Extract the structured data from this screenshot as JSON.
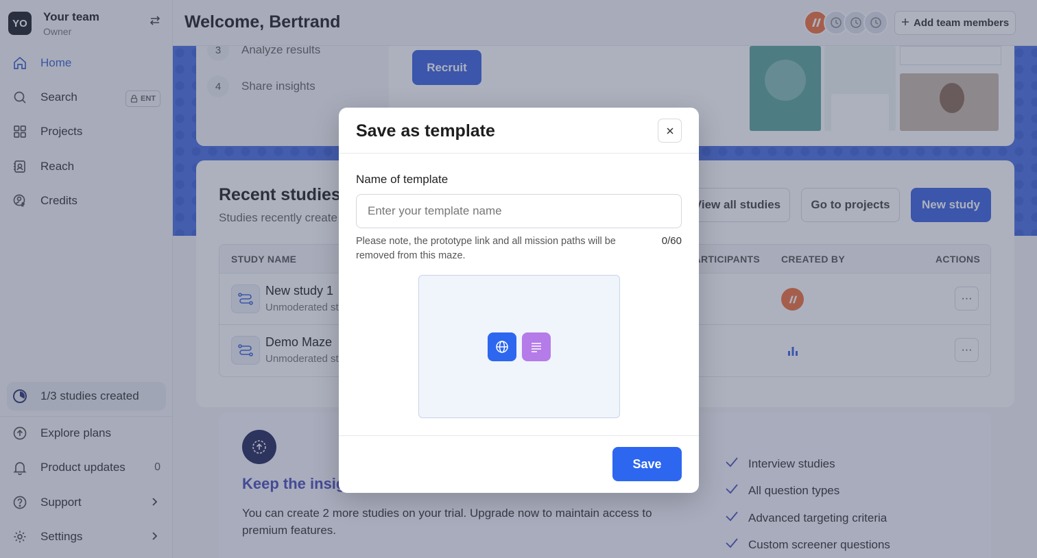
{
  "team": {
    "initials": "YO",
    "name": "Your team",
    "role": "Owner"
  },
  "nav": {
    "home": "Home",
    "search": "Search",
    "search_badge": "ENT",
    "projects": "Projects",
    "reach": "Reach",
    "credits": "Credits"
  },
  "studies_created": "1/3 studies created",
  "bottom_nav": {
    "explore_plans": "Explore plans",
    "product_updates": "Product updates",
    "product_updates_count": "0",
    "support": "Support",
    "settings": "Settings"
  },
  "header": {
    "welcome": "Welcome, Bertrand",
    "add_team": "Add team members"
  },
  "hero": {
    "steps": [
      {
        "num": "3",
        "label": "Analyze results"
      },
      {
        "num": "4",
        "label": "Share insights"
      }
    ],
    "recruit": "Recruit"
  },
  "recent": {
    "title": "Recent studies",
    "subtitle": "Studies recently create",
    "view_all": "View all studies",
    "go_projects": "Go to projects",
    "new_study": "New study",
    "columns": {
      "name": "STUDY NAME",
      "participants": "PARTICIPANTS",
      "created_by": "CREATED BY",
      "actions": "ACTIONS"
    },
    "rows": [
      {
        "name": "New study 1",
        "type": "Unmoderated study"
      },
      {
        "name": "Demo Maze",
        "type": "Unmoderated study"
      }
    ],
    "actions_glyph": "···"
  },
  "upgrade": {
    "title": "Keep the insights flowing",
    "text": "You can create 2 more studies on your trial. Upgrade now to maintain access to premium features.",
    "features": [
      "Interview studies",
      "All question types",
      "Advanced targeting criteria",
      "Custom screener questions"
    ]
  },
  "modal": {
    "title": "Save as template",
    "field_label": "Name of template",
    "placeholder": "Enter your template name",
    "note": "Please note, the prototype link and all mission paths will be removed from this maze.",
    "counter": "0/60",
    "save": "Save"
  },
  "colors": {
    "accent": "#3c63dd",
    "save": "#2d67f0",
    "brand_orange": "#f2703a",
    "purple": "#b57be8"
  }
}
